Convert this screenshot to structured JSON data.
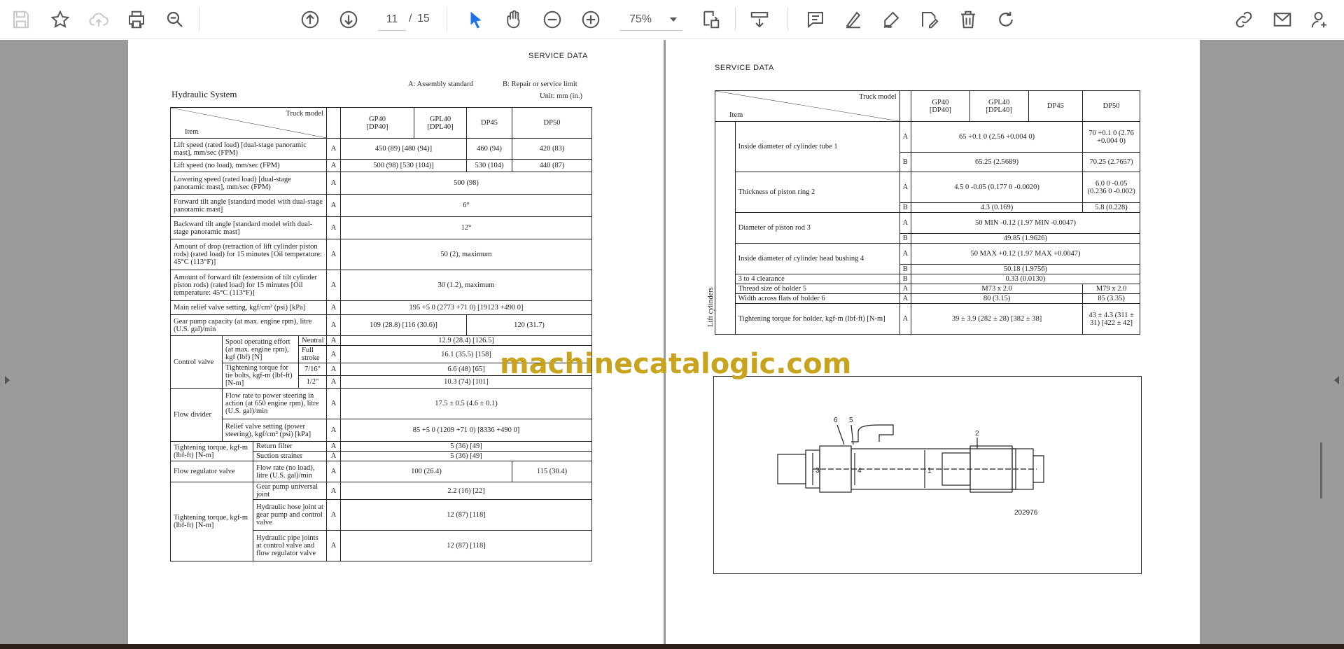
{
  "toolbar": {
    "page_current": "11",
    "page_sep": "/",
    "page_total": "15",
    "zoom": "75%",
    "icons": [
      "save-icon",
      "bookmark-star-icon",
      "cloud-upload-icon",
      "print-icon",
      "zoom-search-icon",
      "page-up-icon",
      "page-down-icon",
      "select-cursor-icon",
      "hand-pan-icon",
      "zoom-out-icon",
      "zoom-in-icon",
      "fit-page-icon",
      "scroll-mode-icon",
      "comment-icon",
      "highlight-icon",
      "draw-icon",
      "fill-sign-icon",
      "delete-icon",
      "rotate-icon",
      "share-link-icon",
      "email-icon",
      "user-add-icon"
    ],
    "accent": "#1a73e8"
  },
  "watermark": "machinecatalogic.com",
  "left_page": {
    "header": "SERVICE DATA",
    "title": "Hydraulic System",
    "legend_a": "A: Assembly standard",
    "legend_b": "B: Repair or service limit",
    "unit": "Unit: mm (in.)",
    "col_header_truck": "Truck model",
    "col_header_item": "Item",
    "models": [
      "GP40\n[DP40]",
      "GPL40\n[DPL40]",
      "DP45",
      "DP50"
    ],
    "rows": [
      {
        "item": "Lift speed (rated load) [dual-stage panoramic mast], mm/sec (FPM)",
        "k": "A",
        "v1": "450 (89) [480 (94)]",
        "v2": "460 (94)",
        "v3": "420 (83)"
      },
      {
        "item": "Lift speed (no load), mm/sec (FPM)",
        "k": "A",
        "v1": "500 (98) [530 (104)]",
        "v2": "530 (104)",
        "v3": "440 (87)"
      },
      {
        "item": "Lowering speed (rated load) [dual-stage panoramic mast], mm/sec (FPM)",
        "k": "A",
        "v": "500 (98)"
      },
      {
        "item": "Forward tilt angle [standard model with dual-stage panoramic mast]",
        "k": "A",
        "v": "6°"
      },
      {
        "item": "Backward tilt angle [standard model with dual-stage panoramic mast]",
        "k": "A",
        "v": "12°"
      },
      {
        "item": "Amount of drop (retraction of lift cylinder piston rods) (rated load) for 15 minutes [Oil temperature: 45°C (113°F)]",
        "k": "A",
        "v": "50 (2), maximum"
      },
      {
        "item": "Amount of forward tilt (extension of tilt cylinder piston rods) (rated load) for 15 minutes [Oil temperature: 45°C (113°F)]",
        "k": "A",
        "v": "30 (1.2), maximum"
      },
      {
        "item": "Main relief valve setting, kgf/cm² (psi) [kPa]",
        "k": "A",
        "v": "195 +5 0 (2773 +71 0) [19123 +490 0]"
      },
      {
        "item": "Gear pump capacity (at max. engine rpm), litre (U.S. gal)/min",
        "k": "A",
        "v1": "109 (28.8) [116 (30.6)]",
        "v2": "120 (31.7)"
      }
    ],
    "control_valve": {
      "label": "Control valve",
      "spool": "Spool operating effort (at max. engine rpm), kgf (lbf) [N]",
      "neutral": "Neutral",
      "neutral_v": "12.9 (28.4) [126.5]",
      "full": "Full stroke",
      "full_v": "16.1 (35.5) [158]",
      "torque": "Tightening torque for tie bolts, kgf-m (lbf-ft) [N-m]",
      "t1": "7/16\"",
      "t1_v": "6.6 (48) [65]",
      "t2": "1/2\"",
      "t2_v": "10.3 (74) [101]"
    },
    "flow_divider": {
      "label": "Flow divider",
      "rate": "Flow rate to power steering in action (at 650 engine rpm), litre (U.S. gal)/min",
      "rate_v": "17.5 ± 0.5 (4.6 ± 0.1)",
      "relief": "Relief valve setting (power steering), kgf/cm² (psi) [kPa]",
      "relief_v": "85 +5 0 (1209 +71 0) [8336 +490 0]"
    },
    "tightening": {
      "label": "Tightening torque, kgf-m (lbf-ft) [N-m]",
      "return": "Return filter",
      "return_v": "5 (36) [49]",
      "suction": "Suction strainer",
      "suction_v": "5 (36) [49]"
    },
    "flow_reg": {
      "label": "Flow regulator valve",
      "item": "Flow rate (no load), litre (U.S. gal)/min",
      "v1": "100 (26.4)",
      "v2": "115 (30.4)"
    },
    "tightening2": {
      "label": "Tightening torque, kgf-m (lbf-ft) [N-m]",
      "j1": "Gear pump universal joint",
      "j1_v": "2.2 (16) [22]",
      "j2": "Hydraulic hose joint at gear pump and control valve",
      "j2_v": "12 (87) [118]",
      "j3": "Hydraulic pipe joints at control valve and flow regulator valve",
      "j3_v": "12 (87) [118]"
    }
  },
  "right_page": {
    "header": "SERVICE DATA",
    "col_header_truck": "Truck model",
    "col_header_item": "Item",
    "models": [
      "GP40\n[DP40]",
      "GPL40\n[DPL40]",
      "DP45",
      "DP50"
    ],
    "side_label": "Lift cylinders",
    "rows": [
      {
        "item": "Inside diameter of cylinder tube 1",
        "a": "65 +0.1 0 (2.56 +0.004 0)",
        "a2": "70 +0.1 0 (2.76 +0.004 0)",
        "b": "65.25 (2.5689)",
        "b2": "70.25 (2.7657)"
      },
      {
        "item": "Thickness of piston ring 2",
        "a": "4.5 0 -0.05 (0.177 0 -0.0020)",
        "a2": "6.0 0 -0.05 (0.236 0 -0.002)",
        "b": "4.3 (0.169)",
        "b2": "5.8 (0.228)"
      },
      {
        "item": "Diameter of piston rod 3",
        "a": "50 MIN -0.12 (1.97 MIN -0.0047)",
        "b": "49.85 (1.9626)"
      },
      {
        "item": "Inside diameter of cylinder head bushing 4",
        "a": "50 MAX +0.12 (1.97 MAX +0.0047)",
        "b": "50.18 (1.9756)"
      }
    ],
    "clearance": {
      "item": "3 to 4 clearance",
      "k": "B",
      "v": "0.33 (0.0130)"
    },
    "thread": {
      "item": "Thread size of holder 5",
      "k": "A",
      "v1": "M73 x 2.0",
      "v2": "M79 x 2.0"
    },
    "width": {
      "item": "Width across flats of holder 6",
      "k": "A",
      "v1": "80 (3.15)",
      "v2": "85 (3.35)"
    },
    "torque": {
      "item": "Tightening torque for holder, kgf-m (lbf-ft) [N-m]",
      "k": "A",
      "v1": "39 ± 3.9 (282 ± 28) [382 ± 38]",
      "v2": "43 ± 4.3 (311 ± 31) [422 ± 42]"
    },
    "figure_id": "202976",
    "callouts": [
      "1",
      "2",
      "3",
      "4",
      "5",
      "6"
    ]
  }
}
